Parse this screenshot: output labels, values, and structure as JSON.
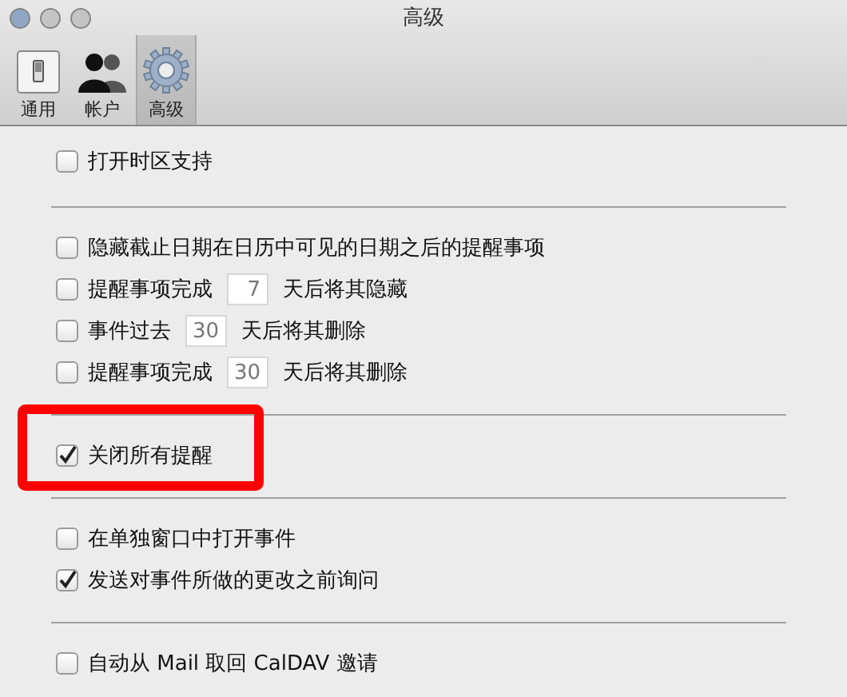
{
  "window": {
    "title": "高级"
  },
  "tabs": [
    {
      "label": "通用",
      "selected": false
    },
    {
      "label": "帐户",
      "selected": false
    },
    {
      "label": "高级",
      "selected": true
    }
  ],
  "sections": [
    {
      "highlighted": false,
      "options": [
        {
          "kind": "check",
          "label": "打开时区支持",
          "checked": false
        }
      ]
    },
    {
      "highlighted": false,
      "options": [
        {
          "kind": "check",
          "label": "隐藏截止日期在日历中可见的日期之后的提醒事项",
          "checked": false
        },
        {
          "kind": "days",
          "label": "提醒事项完成",
          "days": "7",
          "suffix": "天后将其隐藏",
          "checked": false
        },
        {
          "kind": "days",
          "label": "事件过去",
          "days": "30",
          "suffix": "天后将其删除",
          "checked": false
        },
        {
          "kind": "days",
          "label": "提醒事项完成",
          "days": "30",
          "suffix": "天后将其删除",
          "checked": false
        }
      ]
    },
    {
      "highlighted": true,
      "options": [
        {
          "kind": "check",
          "label": "关闭所有提醒",
          "checked": true
        }
      ]
    },
    {
      "highlighted": false,
      "options": [
        {
          "kind": "check",
          "label": "在单独窗口中打开事件",
          "checked": false
        },
        {
          "kind": "check",
          "label": "发送对事件所做的更改之前询问",
          "checked": true
        }
      ]
    },
    {
      "highlighted": false,
      "options": [
        {
          "kind": "check",
          "label": "自动从 Mail 取回 CalDAV 邀请",
          "checked": false
        }
      ]
    }
  ]
}
